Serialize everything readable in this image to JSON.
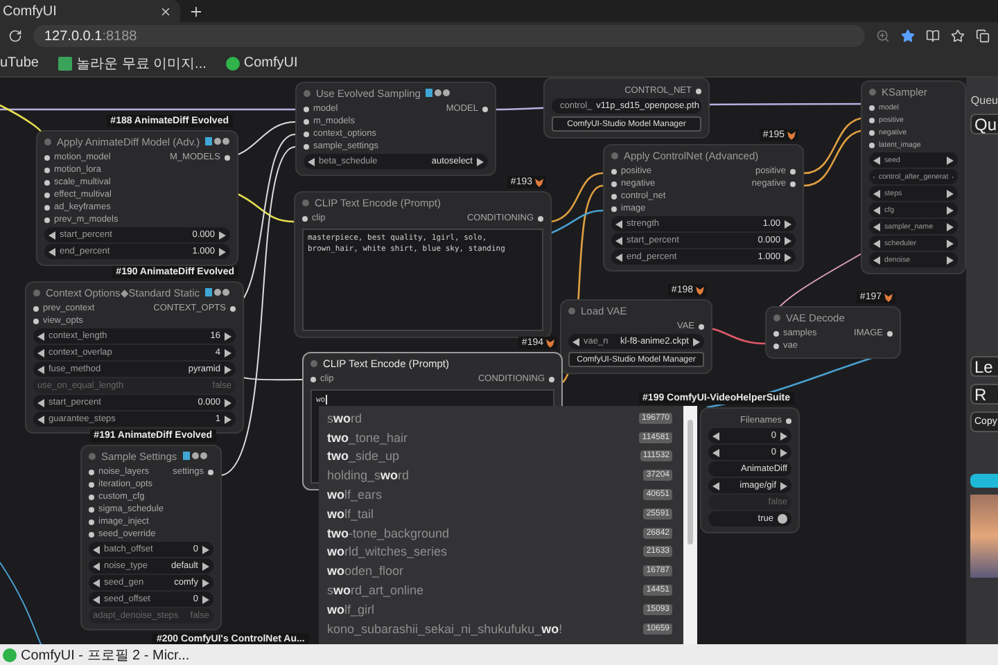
{
  "browser": {
    "tab_title": "ComfyUI",
    "address_host": "127.0.0.1",
    "address_port": ":8188",
    "bookmarks": [
      {
        "label": "uTube",
        "kind": "cut"
      },
      {
        "label": "놀라운 무료 이미지...",
        "kind": "image"
      },
      {
        "label": "ComfyUI",
        "kind": "globe"
      }
    ]
  },
  "nodes": [
    {
      "title": "Use Evolved Sampling",
      "pack_icons": true,
      "inputs": [
        "model",
        "m_models",
        "context_options",
        "sample_settings"
      ],
      "outputs": [
        "MODEL"
      ],
      "widgets": [
        {
          "label": "beta_schedule",
          "value": "autoselect",
          "kind": "stepper"
        }
      ]
    },
    {
      "title": "Apply AnimateDiff Model (Adv.)",
      "badge": "#188 AnimateDiff Evolved",
      "pack_icons": true,
      "inputs": [
        "motion_model",
        "motion_lora",
        "scale_multival",
        "effect_multival",
        "ad_keyframes",
        "prev_m_models"
      ],
      "outputs": [
        "M_MODELS"
      ],
      "widgets": [
        {
          "label": "start_percent",
          "value": "0.000",
          "kind": "stepper"
        },
        {
          "label": "end_percent",
          "value": "1.000",
          "kind": "stepper"
        }
      ]
    },
    {
      "title": "Context Options◆Standard Static",
      "badge": "#190 AnimateDiff Evolved",
      "pack_icons": true,
      "inputs": [
        "prev_context",
        "view_opts"
      ],
      "outputs": [
        "CONTEXT_OPTS"
      ],
      "widgets": [
        {
          "label": "context_length",
          "value": "16",
          "kind": "stepper"
        },
        {
          "label": "context_overlap",
          "value": "4",
          "kind": "stepper"
        },
        {
          "label": "fuse_method",
          "value": "pyramid",
          "kind": "stepper"
        },
        {
          "label": "use_on_equal_length",
          "value": "false",
          "kind": "inactive"
        },
        {
          "label": "start_percent",
          "value": "0.000",
          "kind": "stepper"
        },
        {
          "label": "guarantee_steps",
          "value": "1",
          "kind": "stepper"
        }
      ]
    },
    {
      "title": "Sample Settings",
      "badge": "#191 AnimateDiff Evolved",
      "pack_icons": true,
      "inputs": [
        "noise_layers",
        "iteration_opts",
        "custom_cfg",
        "sigma_schedule",
        "image_inject",
        "seed_override"
      ],
      "outputs": [
        "settings"
      ],
      "widgets": [
        {
          "label": "batch_offset",
          "value": "0",
          "kind": "stepper"
        },
        {
          "label": "noise_type",
          "value": "default",
          "kind": "stepper"
        },
        {
          "label": "seed_gen",
          "value": "comfy",
          "kind": "stepper"
        },
        {
          "label": "seed_offset",
          "value": "0",
          "kind": "stepper"
        },
        {
          "label": "adapt_denoise_steps",
          "value": "false",
          "kind": "inactive"
        }
      ]
    },
    {
      "outputs": [
        "CONTROL_NET"
      ],
      "widgets": [
        {
          "label": "control_",
          "value": "v11p_sd15_openpose.pth",
          "kind": "stepper"
        }
      ],
      "buttons": [
        "ComfyUI-Studio Model Manager"
      ]
    },
    {
      "title": "CLIP Text Encode (Prompt)",
      "id": "#193",
      "inputs": [
        "clip"
      ],
      "outputs": [
        "CONDITIONING"
      ],
      "text": "masterpiece, best quality, 1girl, solo, brown_hair, white shirt, blue sky, standing"
    },
    {
      "title": "Apply ControlNet (Advanced)",
      "id": "#195",
      "inputs": [
        "positive",
        "negative",
        "control_net",
        "image"
      ],
      "outputs": [
        "positive",
        "negative"
      ],
      "widgets": [
        {
          "label": "strength",
          "value": "1.00",
          "kind": "stepper"
        },
        {
          "label": "start_percent",
          "value": "0.000",
          "kind": "stepper"
        },
        {
          "label": "end_percent",
          "value": "1.000",
          "kind": "stepper"
        }
      ]
    },
    {
      "title": "KSampler",
      "inputs": [
        "model",
        "positive",
        "negative",
        "latent_image"
      ],
      "widgets": [
        {
          "label": "seed",
          "kind": "stepper"
        },
        {
          "label": "control_after_generat",
          "kind": "stepper"
        },
        {
          "label": "steps",
          "kind": "stepper"
        },
        {
          "label": "cfg",
          "kind": "stepper"
        },
        {
          "label": "sampler_name",
          "kind": "stepper"
        },
        {
          "label": "scheduler",
          "kind": "stepper"
        },
        {
          "label": "denoise",
          "kind": "stepper"
        }
      ]
    },
    {
      "title": "Load VAE",
      "id": "#198",
      "outputs": [
        "VAE"
      ],
      "widgets": [
        {
          "label": "vae_n",
          "value": "kl-f8-anime2.ckpt",
          "kind": "stepper"
        }
      ],
      "buttons": [
        "ComfyUI-Studio Model Manager"
      ]
    },
    {
      "title": "VAE Decode",
      "id": "#197",
      "inputs": [
        "samples",
        "vae"
      ],
      "outputs": [
        "IMAGE"
      ]
    },
    {
      "title": "CLIP Text Encode (Prompt)",
      "id": "#194",
      "active": true,
      "inputs": [
        "clip"
      ],
      "outputs": [
        "CONDITIONING"
      ],
      "text": "wo"
    },
    {
      "badge": "#199 ComfyUI-VideoHelperSuite",
      "outputs": [
        "Filenames"
      ],
      "widgets": [
        {
          "value": "0",
          "kind": "stepper"
        },
        {
          "value": "0",
          "kind": "stepper"
        },
        {
          "value": "AnimateDiff",
          "kind": "plain"
        },
        {
          "value": "image/gif",
          "kind": "stepper"
        },
        {
          "value": "false",
          "kind": "inactive"
        },
        {
          "value": "true",
          "kind": "toggle"
        }
      ]
    },
    {
      "badge": "#200 ComfyUI's ControlNet Au..."
    }
  ],
  "autocomplete": {
    "items": [
      {
        "label": "s**wo**rd",
        "count": "196770"
      },
      {
        "label": "**two**_tone_hair",
        "count": "114581"
      },
      {
        "label": "**two**_side_up",
        "count": "111532"
      },
      {
        "label": "holding_s**wo**rd",
        "count": "37204"
      },
      {
        "label": "**wo**lf_ears",
        "count": "40651"
      },
      {
        "label": "**wo**lf_tail",
        "count": "25591"
      },
      {
        "label": "**two**-tone_background",
        "count": "26842"
      },
      {
        "label": "**wo**rld_witches_series",
        "count": "21633"
      },
      {
        "label": "**wo**oden_floor",
        "count": "16787"
      },
      {
        "label": "s**wo**rd_art_online",
        "count": "14451"
      },
      {
        "label": "**wo**lf_girl",
        "count": "15093"
      },
      {
        "label": "kono_subarashii_sekai_ni_shukufuku_**wo**!",
        "count": "10659"
      }
    ]
  },
  "side_panel": {
    "title": "Queu",
    "queue_button": "Qu",
    "buttons": [
      "Le",
      "R"
    ],
    "copy_button": "Copy"
  },
  "taskbar": {
    "label": "ComfyUI - 프로필 2 - Micr..."
  }
}
